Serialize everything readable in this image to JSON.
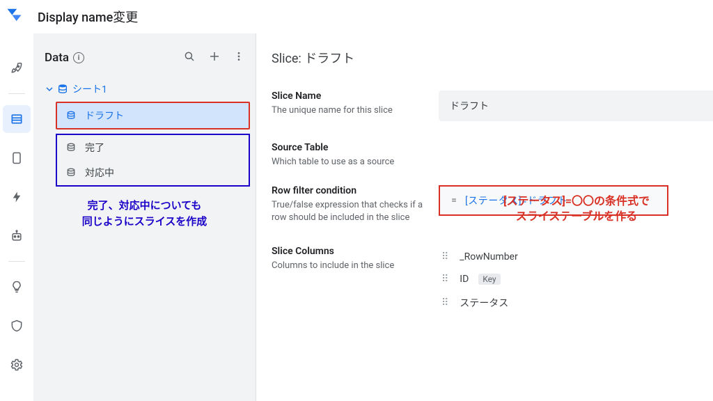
{
  "header": {
    "app_title": "Display name変更"
  },
  "data_panel": {
    "title": "Data",
    "root_node": "シート1",
    "slices": [
      {
        "label": "ドラフト",
        "selected": true
      },
      {
        "label": "完了",
        "selected": false
      },
      {
        "label": "対応中",
        "selected": false
      }
    ]
  },
  "annotations": {
    "blue": "完了、対応中についても\n同じようにスライスを作成",
    "red": "[ステータス]=〇〇の条件式で\nスライステーブルを作る"
  },
  "main": {
    "title_prefix": "Slice:",
    "title_value": "ドラフト",
    "slice_name": {
      "label": "Slice Name",
      "sub": "The unique name for this slice",
      "value": "ドラフト"
    },
    "source_table": {
      "label": "Source Table",
      "sub": "Which table to use as a source"
    },
    "row_filter": {
      "label": "Row filter condition",
      "sub": "True/false expression that checks if a row should be included in the slice",
      "eq": "=",
      "expr": "[ステータス]=ドラフト"
    },
    "slice_columns": {
      "label": "Slice Columns",
      "sub": "Columns to include in the slice",
      "items": [
        {
          "name": "_RowNumber",
          "key": false
        },
        {
          "name": "ID",
          "key": true
        },
        {
          "name": "ステータス",
          "key": false
        }
      ],
      "key_label": "Key"
    }
  }
}
